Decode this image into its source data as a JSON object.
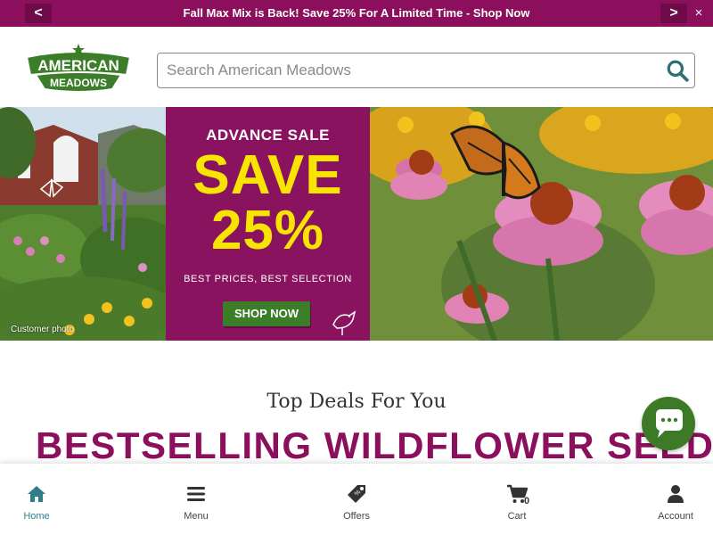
{
  "promo": {
    "prev_label": "<",
    "next_label": ">",
    "message": "Fall Max Mix is Back! Save 25% For A Limited Time - Shop Now",
    "close_label": "×",
    "color": "#8b0f5c"
  },
  "header": {
    "logo_line1": "AMERICAN",
    "logo_line2": "MEADOWS",
    "search_placeholder": "Search American Meadows",
    "brand_green": "#3c7d2a"
  },
  "hero": {
    "photo_caption": "Customer photo",
    "banner_kicker": "ADVANCE SALE",
    "banner_line1": "SAVE",
    "banner_line2": "25%",
    "banner_sub": "BEST PRICES, BEST SELECTION",
    "cta_label": "SHOP NOW",
    "banner_color": "#8a1360",
    "accent_yellow": "#f7e400"
  },
  "deals": {
    "eyebrow": "Top Deals For You",
    "title": "BESTSELLING WILDFLOWER SEEDS,"
  },
  "bottom_nav": {
    "items": [
      {
        "label": "Home",
        "icon": "home-icon",
        "active": true
      },
      {
        "label": "Menu",
        "icon": "menu-icon"
      },
      {
        "label": "Offers",
        "icon": "tag-icon"
      },
      {
        "label": "Cart",
        "icon": "cart-icon"
      },
      {
        "label": "Account",
        "icon": "user-icon"
      }
    ],
    "cart_count": "0"
  }
}
